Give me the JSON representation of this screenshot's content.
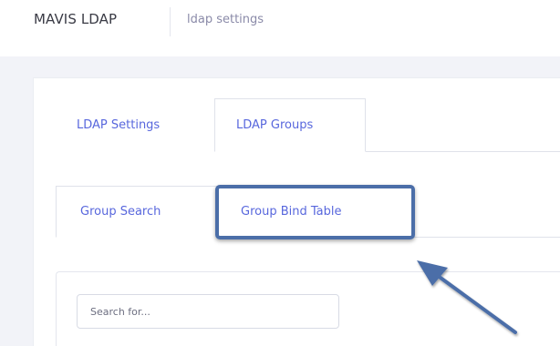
{
  "header": {
    "app_title": "MAVIS LDAP",
    "breadcrumb": "ldap settings"
  },
  "main_tabs": [
    {
      "label": "LDAP Settings",
      "active": false
    },
    {
      "label": "LDAP Groups",
      "active": true
    }
  ],
  "sub_tabs": [
    {
      "label": "Group Search",
      "active": true
    },
    {
      "label": "Group Bind Table",
      "active": false,
      "highlighted": true
    }
  ],
  "search": {
    "placeholder": "Search for...",
    "value": ""
  },
  "colors": {
    "accent": "#5867dd",
    "highlight_border": "#4b6ea8",
    "page_background": "#f2f3f8",
    "arrow": "#4b6ea8"
  },
  "annotation": {
    "arrow_icon": "arrow-pointer-icon"
  }
}
